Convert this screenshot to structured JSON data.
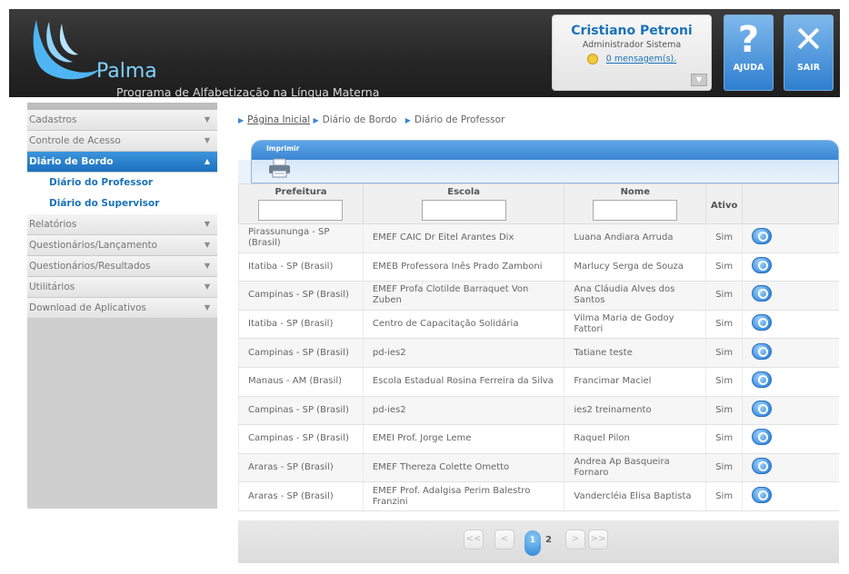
{
  "header": {
    "logo_name": "Palma",
    "subtitle": "Programa de Alfabetização na Língua Materna",
    "user_name": "Cristiano Petroni",
    "user_role": "Administrador Sistema",
    "messages": "0 mensagem(s).",
    "help_label": "AJUDA",
    "exit_label": "SAIR"
  },
  "sidebar": {
    "items": [
      {
        "label": "Cadastros",
        "icon": "chevron-down-icon"
      },
      {
        "label": "Controle de Acesso",
        "icon": "chevron-down-icon"
      },
      {
        "label": "Diário de Bordo",
        "icon": "chevron-up-icon",
        "active": true
      },
      {
        "label": "Relatórios",
        "icon": "chevron-down-icon"
      },
      {
        "label": "Questionários/Lançamento",
        "icon": "chevron-down-icon"
      },
      {
        "label": "Questionários/Resultados",
        "icon": "chevron-down-icon"
      },
      {
        "label": "Utilitários",
        "icon": "chevron-down-icon"
      },
      {
        "label": "Download de Aplicativos",
        "icon": "chevron-down-icon"
      }
    ],
    "subitems": [
      {
        "label": "Diário do Professor"
      },
      {
        "label": "Diário do Supervisor"
      }
    ]
  },
  "breadcrumb": {
    "home": "Página Inicial",
    "level2": "Diário de Bordo",
    "level3": "Diário de Professor"
  },
  "toolbar": {
    "print_label": "Imprimir",
    "print_icon": "printer-icon"
  },
  "table": {
    "columns": [
      "Prefeitura",
      "Escola",
      "Nome",
      "Ativo",
      ""
    ],
    "rows": [
      [
        "Pirassununga - SP (Brasil)",
        "EMEF CAIC Dr Eitel Arantes Dix",
        "Luana Andiara Arruda",
        "Sim"
      ],
      [
        "Itatiba - SP (Brasil)",
        "EMEB Professora Inês Prado Zamboni",
        "Marlucy Serga de Souza",
        "Sim"
      ],
      [
        "Campinas - SP (Brasil)",
        "EMEF Profa Clotilde Barraquet Von Zuben",
        "Ana Cláudia Alves dos Santos",
        "Sim"
      ],
      [
        "Itatiba - SP (Brasil)",
        "Centro de Capacitação Solidária",
        "Vilma Maria de Godoy Fattori",
        "Sim"
      ],
      [
        "Campinas - SP (Brasil)",
        "pd-ies2",
        "Tatiane teste",
        "Sim"
      ],
      [
        "Manaus - AM (Brasil)",
        "Escola Estadual Rosina Ferreira da Silva",
        "Francimar Maciel",
        "Sim"
      ],
      [
        "Campinas - SP (Brasil)",
        "pd-ies2",
        "ies2 treinamento",
        "Sim"
      ],
      [
        "Campinas - SP (Brasil)",
        "EMEI Prof. Jorge Leme",
        "Raquel Pilon",
        "Sim"
      ],
      [
        "Araras - SP (Brasil)",
        "EMEF Thereza Colette Ometto",
        "Andrea Ap Basqueira Fornaro",
        "Sim"
      ],
      [
        "Araras - SP (Brasil)",
        "EMEF Prof. Adalgisa Perim Balestro Franzini",
        "Vandercléia Elisa Baptista",
        "Sim"
      ]
    ]
  },
  "pager": {
    "first": "<<",
    "prev": "<",
    "current": "1",
    "next_page": "2",
    "next": ">",
    "last": ">>"
  },
  "colors": {
    "accent": "#1b72b8",
    "header_bg": "#262626",
    "active_menu": "#2a80c9"
  }
}
